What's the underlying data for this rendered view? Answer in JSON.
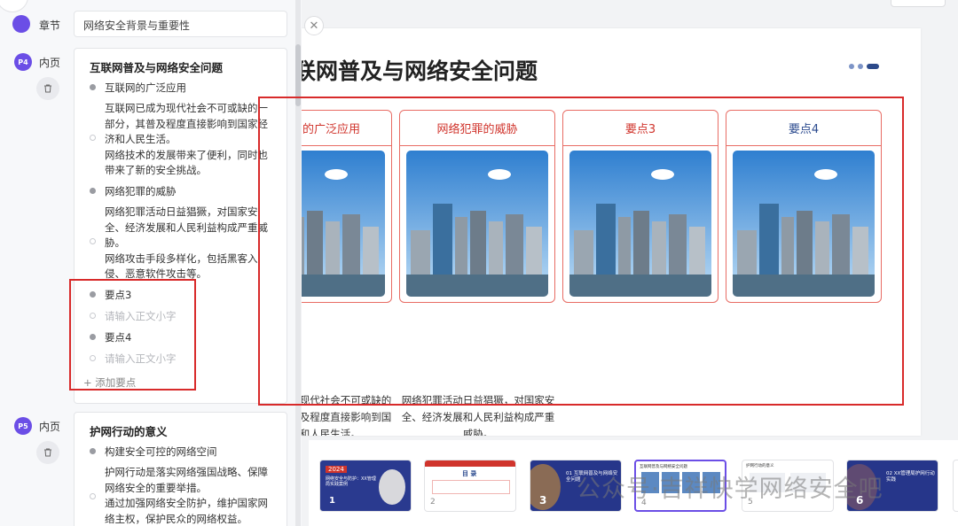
{
  "outline": {
    "top_item_type": "章节",
    "top_item_text": "网络安全背景与重要性",
    "pages": [
      {
        "badge": "P4",
        "type": "内页",
        "title": "互联网普及与网络安全问题",
        "points": [
          {
            "label": "互联网的广泛应用",
            "text": "互联网已成为现代社会不可或缺的一部分，其普及程度直接影响到国家经济和人民生活。\n网络技术的发展带来了便利，同时也带来了新的安全挑战。"
          },
          {
            "label": "网络犯罪的威胁",
            "text": "网络犯罪活动日益猖獗，对国家安全、经济发展和人民利益构成严重威胁。\n网络攻击手段多样化，包括黑客入侵、恶意软件攻击等。"
          },
          {
            "label": "要点3",
            "placeholder": "请输入正文小字"
          },
          {
            "label": "要点4",
            "placeholder": "请输入正文小字"
          }
        ],
        "add_point": "添加要点"
      },
      {
        "badge": "P5",
        "type": "内页",
        "title": "护网行动的意义",
        "points": [
          {
            "label": "构建安全可控的网络空间",
            "text": "护网行动是落实网络强国战略、保障网络安全的重要举措。\n通过加强网络安全防护，维护国家网络主权，保护民众的网络权益。"
          }
        ]
      }
    ]
  },
  "slide": {
    "title": "互联网普及与网络安全问题",
    "columns": [
      {
        "heading": "互联网的广泛应用",
        "body": "互联网已成为现代社会不可或缺的一部分，其普及程度直接影响到国家经济和人民生活。\n网络技术的发展带来了便利，同时也带来了新的安全挑战。"
      },
      {
        "heading": "网络犯罪的威胁",
        "body": "网络犯罪活动日益猖獗，对国家安全、经济发展和人民利益构成严重威胁。\n网络攻击手段多样化，包括黑客入侵、恶意软件攻击等。"
      },
      {
        "heading": "要点3",
        "body": ""
      },
      {
        "heading": "要点4",
        "body": ""
      }
    ]
  },
  "thumbnails": [
    {
      "index": "1",
      "caption": "2024",
      "subtitle": "网络安全与防护：XX管理局实践案例"
    },
    {
      "index": "2",
      "caption": "目 录"
    },
    {
      "index": "3",
      "caption": "01 互联网普及与网络安全问题"
    },
    {
      "index": "4",
      "caption": "互联网普及与网络安全问题",
      "active": true
    },
    {
      "index": "5",
      "caption": "护网行动的意义"
    },
    {
      "index": "6",
      "caption": "02 XX管理局护网行动实践"
    }
  ],
  "watermark": "公众号·吉祥快学网络安全吧",
  "colors": {
    "accent": "#6b4ee6",
    "red": "#d0342c",
    "navy": "#2b4a8e",
    "annotation": "#d82a2a"
  }
}
